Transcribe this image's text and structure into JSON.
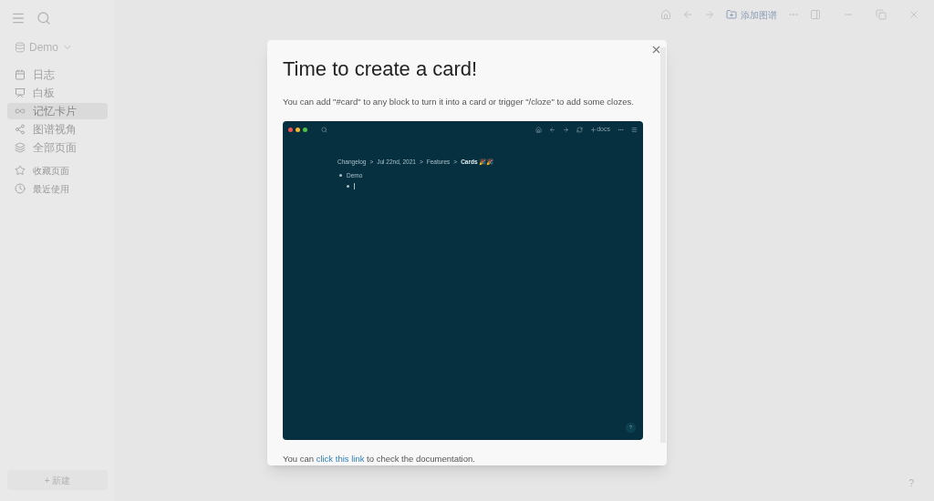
{
  "sidebar": {
    "graph": "Demo",
    "items": [
      {
        "label": "日志",
        "selected": false
      },
      {
        "label": "白板",
        "selected": false
      },
      {
        "label": "记忆卡片",
        "selected": true
      },
      {
        "label": "图谱视角",
        "selected": false
      },
      {
        "label": "全部页面",
        "selected": false
      }
    ],
    "sections": [
      {
        "label": "收藏页面"
      },
      {
        "label": "最近使用"
      }
    ],
    "new_button": "+ 新建"
  },
  "toolbar": {
    "add_graph": "添加图谱"
  },
  "help": "?",
  "dialog": {
    "title": "Time to create a card!",
    "intro": "You can add \"#card\" to any block to turn it into a card or trigger \"/cloze\" to add some clozes.",
    "demo": {
      "docs": "docs",
      "breadcrumb": [
        "Changelog",
        "Jul 22nd, 2021",
        "Features",
        "Cards 🎉🎉"
      ],
      "separator": ">",
      "blocks": [
        {
          "kind": "text",
          "text": "Demo"
        },
        {
          "kind": "cursor"
        }
      ],
      "help": "?"
    },
    "footer_before": "You can ",
    "link": "click this link",
    "footer_after": " to check the documentation."
  }
}
